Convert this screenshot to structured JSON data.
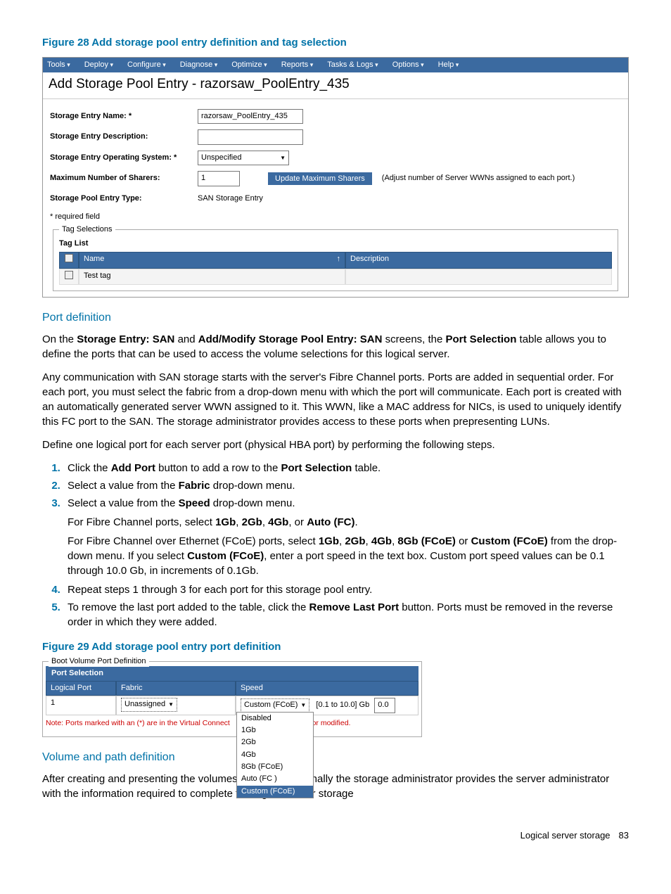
{
  "figure28": "Figure 28 Add storage pool entry definition and tag selection",
  "shot1": {
    "menu": [
      "Tools",
      "Deploy",
      "Configure",
      "Diagnose",
      "Optimize",
      "Reports",
      "Tasks & Logs",
      "Options",
      "Help"
    ],
    "title": "Add Storage Pool Entry - razorsaw_PoolEntry_435",
    "labs": {
      "name": "Storage Entry Name: *",
      "desc": "Storage Entry Description:",
      "os": "Storage Entry Operating System: *",
      "max": "Maximum Number of Sharers:",
      "type": "Storage Pool Entry Type:"
    },
    "vals": {
      "name": "razorsaw_PoolEntry_435",
      "os": "Unspecified",
      "max": "1",
      "type": "SAN Storage Entry"
    },
    "updateBtn": "Update Maximum Sharers",
    "adjust": "(Adjust number of Server WWNs assigned to each port.)",
    "required": "* required field",
    "tagLegend": "Tag Selections",
    "tagList": "Tag List",
    "colName": "Name",
    "colDesc": "Description",
    "rowName": "Test tag",
    "arrowUp": "↑"
  },
  "portDefTitle": "Port definition",
  "para1a": "On the ",
  "para1b": "Storage Entry: SAN",
  "para1c": " and ",
  "para1d": "Add/Modify Storage Pool Entry: SAN",
  "para1e": " screens, the ",
  "para1f": "Port Selection",
  "para1g": " table allows you to define the ports that can be used to access the volume selections for this logical server.",
  "para2": "Any communication with SAN storage starts with the server's Fibre Channel ports. Ports are added in sequential order. For each port, you must select the fabric from a drop-down menu with which the port will communicate. Each port is created with an automatically generated server WWN assigned to it. This WWN, like a MAC address for NICs, is used to uniquely identify this FC port to the SAN. The storage administrator provides access to these ports when prepresenting LUNs.",
  "para3": "Define one logical port for each server port (physical HBA port) by performing the following steps.",
  "step1a": "Click the ",
  "step1b": "Add Port",
  "step1c": " button to add a row to the ",
  "step1d": "Port Selection",
  "step1e": " table.",
  "step2a": "Select a value from the ",
  "step2b": "Fabric",
  "step2c": " drop-down menu.",
  "step3a": "Select a value from the ",
  "step3b": "Speed",
  "step3c": " drop-down menu.",
  "step3fca": "For Fibre Channel ports, select ",
  "g1": "1Gb",
  "g2": "2Gb",
  "g4": "4Gb",
  "gauto": "Auto (FC)",
  "or": ", or ",
  "comma": ", ",
  "period": ".",
  "step3fcoea": "For Fibre Channel over Ethernet (FCoE) ports, select ",
  "g8": "8Gb (FCoE)",
  "or2": " or ",
  "gcust": "Custom (FCoE)",
  "step3fcoeb": " from the drop-down menu. If you select ",
  "step3fcoec": ", enter a port speed in the text box. Custom port speed values can be 0.1 through 10.0 Gb, in increments of 0.1Gb.",
  "step4": "Repeat steps 1 through 3 for each port for this storage pool entry.",
  "step5a": "To remove the last port added to the table, click the ",
  "step5b": "Remove Last Port",
  "step5c": " button. Ports must be removed in the reverse order in which they were added.",
  "figure29": "Figure 29 Add storage pool entry port definition",
  "shot2": {
    "legend": "Boot Volume Port Definition",
    "ps": "Port Selection",
    "lp": "Logical Port",
    "fab": "Fabric",
    "spd": "Speed",
    "r_lp": "1",
    "r_fab": "Unassigned",
    "r_spd_sel": "Custom (FCoE)",
    "r_spd_rng": "[0.1 to 10.0] Gb",
    "r_spd_val": "0.0",
    "noteA": "Note: Ports marked with an (*) are in the Virtual Connect ",
    "noteB": "e deleted or modified.",
    "opts": [
      "Disabled",
      "1Gb",
      "2Gb",
      "4Gb",
      "8Gb (FCoE)",
      "Auto (FC )",
      "Custom (FCoE)"
    ]
  },
  "volTitle": "Volume and path definition",
  "volPara": "After creating and presenting the volumes (LUNs), traditionally the storage administrator provides the server administrator with the information required to complete the logical server storage",
  "footer": {
    "label": "Logical server storage",
    "page": "83"
  }
}
